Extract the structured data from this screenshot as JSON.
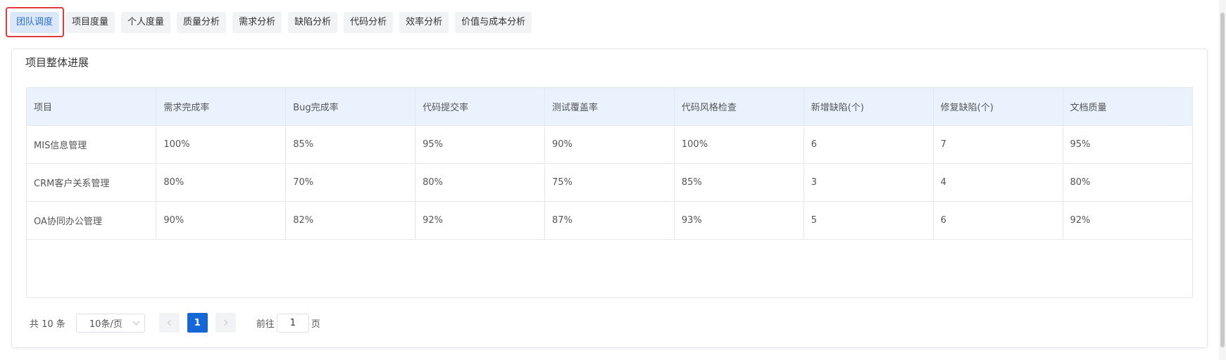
{
  "tabs": [
    {
      "label": "团队调度",
      "active": true
    },
    {
      "label": "项目度量",
      "active": false
    },
    {
      "label": "个人度量",
      "active": false
    },
    {
      "label": "质量分析",
      "active": false
    },
    {
      "label": "需求分析",
      "active": false
    },
    {
      "label": "缺陷分析",
      "active": false
    },
    {
      "label": "代码分析",
      "active": false
    },
    {
      "label": "效率分析",
      "active": false
    },
    {
      "label": "价值与成本分析",
      "active": false
    }
  ],
  "card": {
    "title": "项目整体进展",
    "columns": [
      "项目",
      "需求完成率",
      "Bug完成率",
      "代码提交率",
      "测试覆盖率",
      "代码风格检查",
      "新增缺陷(个)",
      "修复缺陷(个)",
      "文档质量"
    ],
    "rows": [
      [
        "MIS信息管理",
        "100%",
        "85%",
        "95%",
        "90%",
        "100%",
        "6",
        "7",
        "95%"
      ],
      [
        "CRM客户关系管理",
        "80%",
        "70%",
        "80%",
        "75%",
        "85%",
        "3",
        "4",
        "80%"
      ],
      [
        "OA协同办公管理",
        "90%",
        "82%",
        "92%",
        "87%",
        "93%",
        "5",
        "6",
        "92%"
      ]
    ]
  },
  "pagination": {
    "total": "共 10 条",
    "page_size": "10条/页",
    "current_page": "1",
    "goto_label": "前往",
    "goto_value": "1",
    "page_suffix": "页"
  },
  "colors": {
    "accent": "#1766d6",
    "active_tab_bg": "#dbe8f9",
    "highlight_border": "#e03a3a",
    "header_bg": "#eaf2fd"
  }
}
